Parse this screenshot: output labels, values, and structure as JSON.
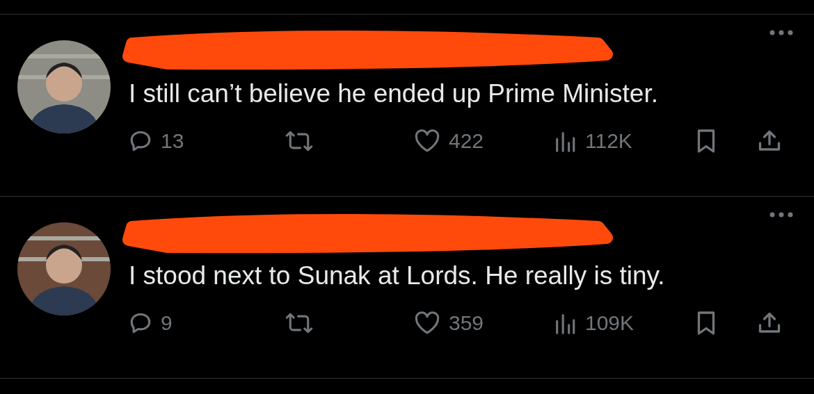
{
  "tweets": [
    {
      "text": "I still can’t believe he ended up Prime Minister.",
      "replies": "13",
      "likes": "422",
      "views": "112K"
    },
    {
      "text": "I stood next to Sunak at Lords. He really is tiny.",
      "replies": "9",
      "likes": "359",
      "views": "109K"
    }
  ]
}
